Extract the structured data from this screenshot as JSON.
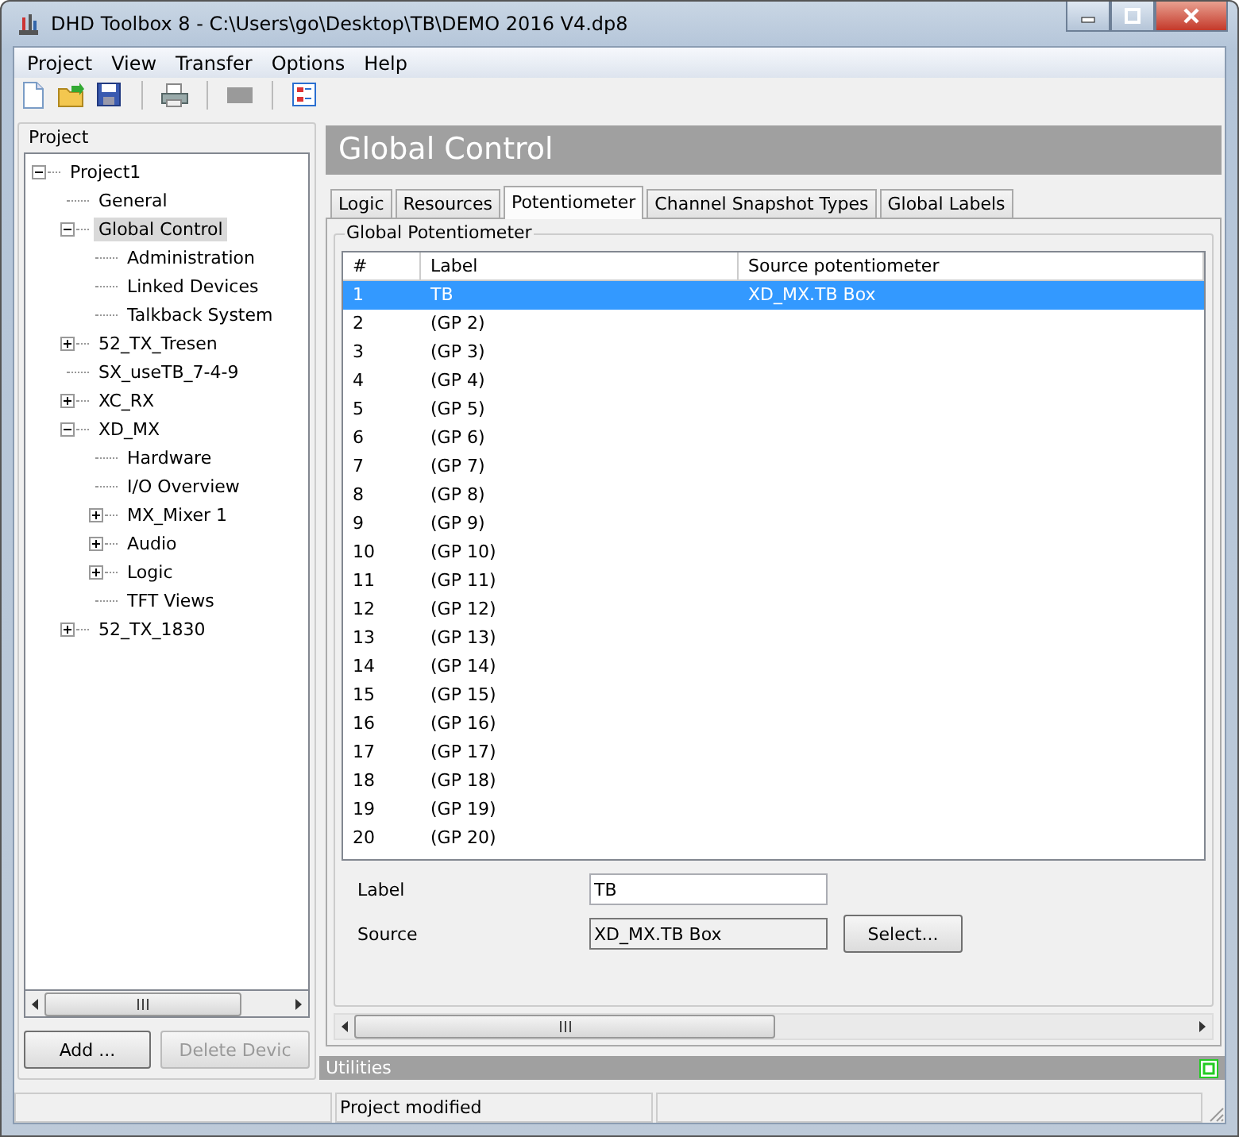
{
  "window": {
    "title": "DHD Toolbox 8 - C:\\Users\\go\\Desktop\\TB\\DEMO 2016 V4.dp8"
  },
  "menu": [
    {
      "label": "Project"
    },
    {
      "label": "View"
    },
    {
      "label": "Transfer"
    },
    {
      "label": "Options"
    },
    {
      "label": "Help"
    }
  ],
  "toolbar": [
    {
      "kind": "new"
    },
    {
      "kind": "open"
    },
    {
      "kind": "save"
    },
    {
      "kind": "separator"
    },
    {
      "kind": "print"
    },
    {
      "kind": "separator"
    },
    {
      "kind": "blank",
      "disabled": true
    },
    {
      "kind": "separator"
    },
    {
      "kind": "properties"
    }
  ],
  "sidebar": {
    "title": "Project",
    "tree": [
      {
        "label": "Project1",
        "kind": "branch",
        "expanded": true,
        "selected": false,
        "children": [
          {
            "label": "General",
            "kind": "leaf",
            "selected": false
          },
          {
            "label": "Global Control",
            "kind": "branch",
            "expanded": true,
            "selected": true,
            "children": [
              {
                "label": "Administration",
                "kind": "leaf",
                "selected": false
              },
              {
                "label": "Linked Devices",
                "kind": "leaf",
                "selected": false
              },
              {
                "label": "Talkback System",
                "kind": "leaf",
                "selected": false
              }
            ]
          },
          {
            "label": "52_TX_Tresen",
            "kind": "branch",
            "expanded": false,
            "selected": false
          },
          {
            "label": "SX_useTB_7-4-9",
            "kind": "leaf",
            "selected": false
          },
          {
            "label": "XC_RX",
            "kind": "branch",
            "expanded": false,
            "selected": false
          },
          {
            "label": "XD_MX",
            "kind": "branch",
            "expanded": true,
            "selected": false,
            "children": [
              {
                "label": "Hardware",
                "kind": "leaf",
                "selected": false
              },
              {
                "label": "I/O Overview",
                "kind": "leaf",
                "selected": false
              },
              {
                "label": "MX_Mixer 1",
                "kind": "branch",
                "expanded": false,
                "selected": false
              },
              {
                "label": "Audio",
                "kind": "branch",
                "expanded": false,
                "selected": false
              },
              {
                "label": "Logic",
                "kind": "branch",
                "expanded": false,
                "selected": false
              },
              {
                "label": "TFT Views",
                "kind": "leaf",
                "selected": false
              }
            ]
          },
          {
            "label": "52_TX_1830",
            "kind": "branch",
            "expanded": false,
            "selected": false
          }
        ]
      }
    ],
    "buttons": [
      {
        "label": "Add ...",
        "disabled": false
      },
      {
        "label": "Delete Devic",
        "disabled": true
      }
    ]
  },
  "header": {
    "title": "Global Control"
  },
  "tabs": [
    {
      "label": "Logic",
      "selected": false
    },
    {
      "label": "Resources",
      "selected": false
    },
    {
      "label": "Potentiometer",
      "selected": true
    },
    {
      "label": "Channel Snapshot Types",
      "selected": false
    },
    {
      "label": "Global Labels",
      "selected": false
    }
  ],
  "group": {
    "title": "Global Potentiometer"
  },
  "table": {
    "columns": [
      "#",
      "Label",
      "Source potentiometer"
    ],
    "rows": [
      {
        "cells": [
          "1",
          "TB",
          "XD_MX.TB Box"
        ],
        "selected": true
      },
      {
        "cells": [
          "2",
          "(GP 2)"
        ],
        "selected": false
      },
      {
        "cells": [
          "3",
          "(GP 3)"
        ],
        "selected": false
      },
      {
        "cells": [
          "4",
          "(GP 4)"
        ],
        "selected": false
      },
      {
        "cells": [
          "5",
          "(GP 5)"
        ],
        "selected": false
      },
      {
        "cells": [
          "6",
          "(GP 6)"
        ],
        "selected": false
      },
      {
        "cells": [
          "7",
          "(GP 7)"
        ],
        "selected": false
      },
      {
        "cells": [
          "8",
          "(GP 8)"
        ],
        "selected": false
      },
      {
        "cells": [
          "9",
          "(GP 9)"
        ],
        "selected": false
      },
      {
        "cells": [
          "10",
          "(GP 10)"
        ],
        "selected": false
      },
      {
        "cells": [
          "11",
          "(GP 11)"
        ],
        "selected": false
      },
      {
        "cells": [
          "12",
          "(GP 12)"
        ],
        "selected": false
      },
      {
        "cells": [
          "13",
          "(GP 13)"
        ],
        "selected": false
      },
      {
        "cells": [
          "14",
          "(GP 14)"
        ],
        "selected": false
      },
      {
        "cells": [
          "15",
          "(GP 15)"
        ],
        "selected": false
      },
      {
        "cells": [
          "16",
          "(GP 16)"
        ],
        "selected": false
      },
      {
        "cells": [
          "17",
          "(GP 17)"
        ],
        "selected": false
      },
      {
        "cells": [
          "18",
          "(GP 18)"
        ],
        "selected": false
      },
      {
        "cells": [
          "19",
          "(GP 19)"
        ],
        "selected": false
      },
      {
        "cells": [
          "20",
          "(GP 20)"
        ],
        "selected": false
      }
    ]
  },
  "form": {
    "label_field": {
      "label": "Label",
      "value": "TB"
    },
    "source_field": {
      "label": "Source",
      "value": "XD_MX.TB Box",
      "disabled": true
    },
    "select_button": "Select..."
  },
  "utilities": {
    "title": "Utilities"
  },
  "status_bar": {
    "message": "Project modified"
  }
}
